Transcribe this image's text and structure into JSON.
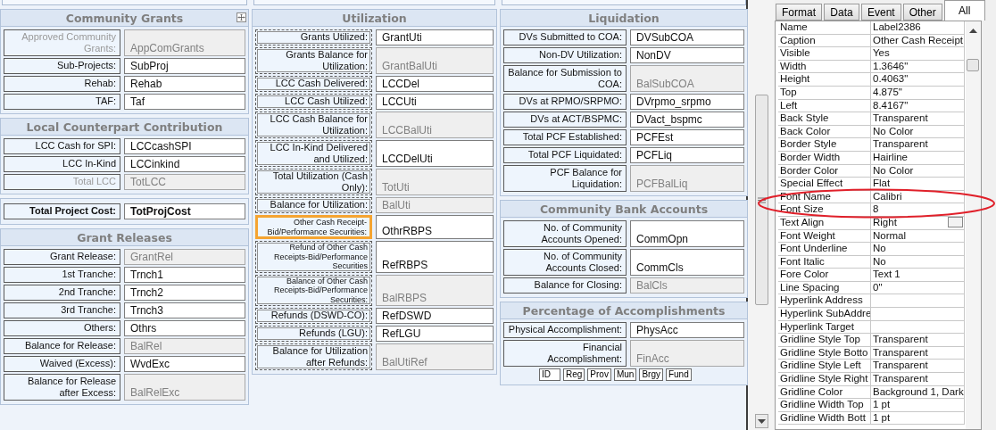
{
  "form": {
    "columns": [
      {
        "sections": [
          {
            "kind": "group",
            "title": "Community Grants",
            "outlined": false,
            "rows": [
              {
                "label": "Approved Community Grants:",
                "value": "AppComGrants",
                "locked": true,
                "dimmed": true,
                "selected": false
              },
              {
                "label": "Sub-Projects:",
                "value": "SubProj",
                "locked": false,
                "dimmed": false,
                "selected": false
              },
              {
                "label": "Rehab:",
                "value": "Rehab",
                "locked": false,
                "dimmed": false,
                "selected": false
              },
              {
                "label": "TAF:",
                "value": "Taf",
                "locked": false,
                "dimmed": false,
                "selected": false
              }
            ]
          },
          {
            "kind": "group",
            "title": "Local Counterpart Contribution",
            "outlined": false,
            "rows": [
              {
                "label": "LCC Cash for SPI:",
                "value": "LCCcashSPI",
                "locked": false,
                "dimmed": false,
                "selected": false
              },
              {
                "label": "LCC In-Kind",
                "value": "LCCinkind",
                "locked": false,
                "dimmed": false,
                "selected": false
              },
              {
                "label": "Total LCC",
                "value": "TotLCC",
                "locked": true,
                "dimmed": true,
                "selected": false
              }
            ]
          },
          {
            "kind": "total",
            "outlined": false,
            "rows": [
              {
                "label": "Total Project Cost:",
                "value": "TotProjCost",
                "locked": false,
                "dimmed": false,
                "selected": false
              }
            ]
          },
          {
            "kind": "group",
            "title": "Grant Releases",
            "outlined": false,
            "rows": [
              {
                "label": "Grant Release:",
                "value": "GrantRel",
                "locked": true,
                "dimmed": false,
                "selected": false
              },
              {
                "label": "1st Tranche:",
                "value": "Trnch1",
                "locked": false,
                "dimmed": false,
                "selected": false
              },
              {
                "label": "2nd Tranche:",
                "value": "Trnch2",
                "locked": false,
                "dimmed": false,
                "selected": false
              },
              {
                "label": "3rd Tranche:",
                "value": "Trnch3",
                "locked": false,
                "dimmed": false,
                "selected": false
              },
              {
                "label": "Others:",
                "value": "Othrs",
                "locked": false,
                "dimmed": false,
                "selected": false
              },
              {
                "label": "Balance for Release:",
                "value": "BalRel",
                "locked": true,
                "dimmed": false,
                "selected": false
              },
              {
                "label": "Waived (Excess):",
                "value": "WvdExc",
                "locked": false,
                "dimmed": false,
                "selected": false
              },
              {
                "label": "Balance for Release after Excess:",
                "value": "BalRelExc",
                "locked": true,
                "dimmed": false,
                "selected": false
              }
            ]
          }
        ]
      },
      {
        "sections": [
          {
            "kind": "group",
            "title": "Utilization",
            "outlined": true,
            "rows": [
              {
                "label": "Grants Utilized:",
                "value": "GrantUti",
                "locked": false,
                "dimmed": false,
                "selected": false
              },
              {
                "label": "Grants Balance for Utilization:",
                "value": "GrantBalUti",
                "locked": true,
                "dimmed": false,
                "selected": false
              },
              {
                "label": "LCC Cash Delivered:",
                "value": "LCCDel",
                "locked": false,
                "dimmed": false,
                "selected": false
              },
              {
                "label": "LCC Cash Utilized:",
                "value": "LCCUti",
                "locked": false,
                "dimmed": false,
                "selected": false
              },
              {
                "label": "LCC Cash Balance for Utilization:",
                "value": "LCCBalUti",
                "locked": true,
                "dimmed": false,
                "selected": false
              },
              {
                "label": "LCC In-Kind Delivered and Utilized:",
                "value": "LCCDelUti",
                "locked": false,
                "dimmed": false,
                "selected": false
              },
              {
                "label": "Total Utilization (Cash Only):",
                "value": "TotUti",
                "locked": true,
                "dimmed": false,
                "selected": false
              },
              {
                "label": "Balance for Utilization:",
                "value": "BalUti",
                "locked": true,
                "dimmed": false,
                "selected": false
              },
              {
                "label": "Other Cash Receipt-Bid/Performance Securities:",
                "value": "OthrRBPS",
                "locked": false,
                "dimmed": false,
                "selected": true
              },
              {
                "label": "Refund of Other Cash Receipts-Bid/Performance Securities",
                "value": "RefRBPS",
                "locked": false,
                "dimmed": false,
                "selected": false
              },
              {
                "label": "Balance of Other Cash Receipts-Bid/Performance Securities:",
                "value": "BalRBPS",
                "locked": true,
                "dimmed": false,
                "selected": false
              },
              {
                "label": "Refunds (DSWD-CO):",
                "value": "RefDSWD",
                "locked": false,
                "dimmed": false,
                "selected": false
              },
              {
                "label": "Refunds (LGU):",
                "value": "RefLGU",
                "locked": false,
                "dimmed": false,
                "selected": false
              },
              {
                "label": "Balance for Utilization after Refunds:",
                "value": "BalUtiRef",
                "locked": true,
                "dimmed": false,
                "selected": false
              }
            ]
          }
        ]
      },
      {
        "sections": [
          {
            "kind": "group",
            "title": "Liquidation",
            "outlined": false,
            "rows": [
              {
                "label": "DVs Submitted to COA:",
                "value": "DVSubCOA",
                "locked": false,
                "dimmed": false,
                "selected": false
              },
              {
                "label": "Non-DV Utilization:",
                "value": "NonDV",
                "locked": false,
                "dimmed": false,
                "selected": false
              },
              {
                "label": "Balance for Submission to COA:",
                "value": "BalSubCOA",
                "locked": true,
                "dimmed": false,
                "selected": false
              },
              {
                "label": "DVs at RPMO/SRPMO:",
                "value": "DVrpmo_srpmo",
                "locked": false,
                "dimmed": false,
                "selected": false
              },
              {
                "label": "DVs at ACT/BSPMC:",
                "value": "DVact_bspmc",
                "locked": false,
                "dimmed": false,
                "selected": false
              },
              {
                "label": "Total PCF Established:",
                "value": "PCFEst",
                "locked": false,
                "dimmed": false,
                "selected": false
              },
              {
                "label": "Total PCF Liquidated:",
                "value": "PCFLiq",
                "locked": false,
                "dimmed": false,
                "selected": false
              },
              {
                "label": "PCF Balance for Liquidation:",
                "value": "PCFBalLiq",
                "locked": true,
                "dimmed": false,
                "selected": false
              }
            ]
          },
          {
            "kind": "group",
            "title": "Community Bank Accounts",
            "outlined": false,
            "rows": [
              {
                "label": "No. of Community Accounts Opened:",
                "value": "CommOpn",
                "locked": false,
                "dimmed": false,
                "selected": false
              },
              {
                "label": "No. of Community Accounts Closed:",
                "value": "CommCls",
                "locked": false,
                "dimmed": false,
                "selected": false
              },
              {
                "label": "Balance for Closing:",
                "value": "BalCls",
                "locked": true,
                "dimmed": false,
                "selected": false
              }
            ]
          },
          {
            "kind": "group",
            "title": "Percentage of Accomplishments",
            "outlined": false,
            "rows": [
              {
                "label": "Physical Accomplishment:",
                "value": "PhysAcc",
                "locked": false,
                "dimmed": false,
                "selected": false
              },
              {
                "label": "Financial Accomplishment:",
                "value": "FinAcc",
                "locked": true,
                "dimmed": false,
                "selected": false
              }
            ],
            "small_fields": [
              "ID",
              "Reg",
              "Prov",
              "Mun",
              "Brgy",
              "Fund"
            ]
          }
        ]
      }
    ]
  },
  "property_sheet": {
    "tabs": [
      {
        "label": "Format",
        "selected": false
      },
      {
        "label": "Data",
        "selected": false
      },
      {
        "label": "Event",
        "selected": false
      },
      {
        "label": "Other",
        "selected": false
      },
      {
        "label": "All",
        "selected": true
      }
    ],
    "properties": [
      {
        "name": "Name",
        "value": "Label2386",
        "selected": false
      },
      {
        "name": "Caption",
        "value": "Other Cash Receipt",
        "selected": false
      },
      {
        "name": "Visible",
        "value": "Yes",
        "selected": false
      },
      {
        "name": "Width",
        "value": "1.3646\"",
        "selected": false
      },
      {
        "name": "Height",
        "value": "0.4063\"",
        "selected": false
      },
      {
        "name": "Top",
        "value": "4.875\"",
        "selected": false
      },
      {
        "name": "Left",
        "value": "8.4167\"",
        "selected": false
      },
      {
        "name": "Back Style",
        "value": "Transparent",
        "selected": false
      },
      {
        "name": "Back Color",
        "value": "No Color",
        "selected": false
      },
      {
        "name": "Border Style",
        "value": "Transparent",
        "selected": false
      },
      {
        "name": "Border Width",
        "value": "Hairline",
        "selected": false
      },
      {
        "name": "Border Color",
        "value": "No Color",
        "selected": false
      },
      {
        "name": "Special Effect",
        "value": "Flat",
        "selected": false
      },
      {
        "name": "Font Name",
        "value": "Calibri",
        "selected": false
      },
      {
        "name": "Font Size",
        "value": "8",
        "selected": false
      },
      {
        "name": "Text Align",
        "value": "Right",
        "selected": true
      },
      {
        "name": "Font Weight",
        "value": "Normal",
        "selected": false
      },
      {
        "name": "Font Underline",
        "value": "No",
        "selected": false
      },
      {
        "name": "Font Italic",
        "value": "No",
        "selected": false
      },
      {
        "name": "Fore Color",
        "value": "Text 1",
        "selected": false
      },
      {
        "name": "Line Spacing",
        "value": "0\"",
        "selected": false
      },
      {
        "name": "Hyperlink Address",
        "selected": false
      },
      {
        "name": "Hyperlink SubAddre",
        "selected": false
      },
      {
        "name": "Hyperlink Target",
        "selected": false
      },
      {
        "name": "Gridline Style Top",
        "value": "Transparent",
        "selected": false
      },
      {
        "name": "Gridline Style Botto",
        "value": "Transparent",
        "selected": false
      },
      {
        "name": "Gridline Style Left",
        "value": "Transparent",
        "selected": false
      },
      {
        "name": "Gridline Style Right",
        "value": "Transparent",
        "selected": false
      },
      {
        "name": "Gridline Color",
        "value": "Background 1, Dark",
        "selected": false
      },
      {
        "name": "Gridline Width Top",
        "value": "1 pt",
        "selected": false
      },
      {
        "name": "Gridline Width Bott",
        "value": "1 pt",
        "selected": false
      }
    ]
  }
}
